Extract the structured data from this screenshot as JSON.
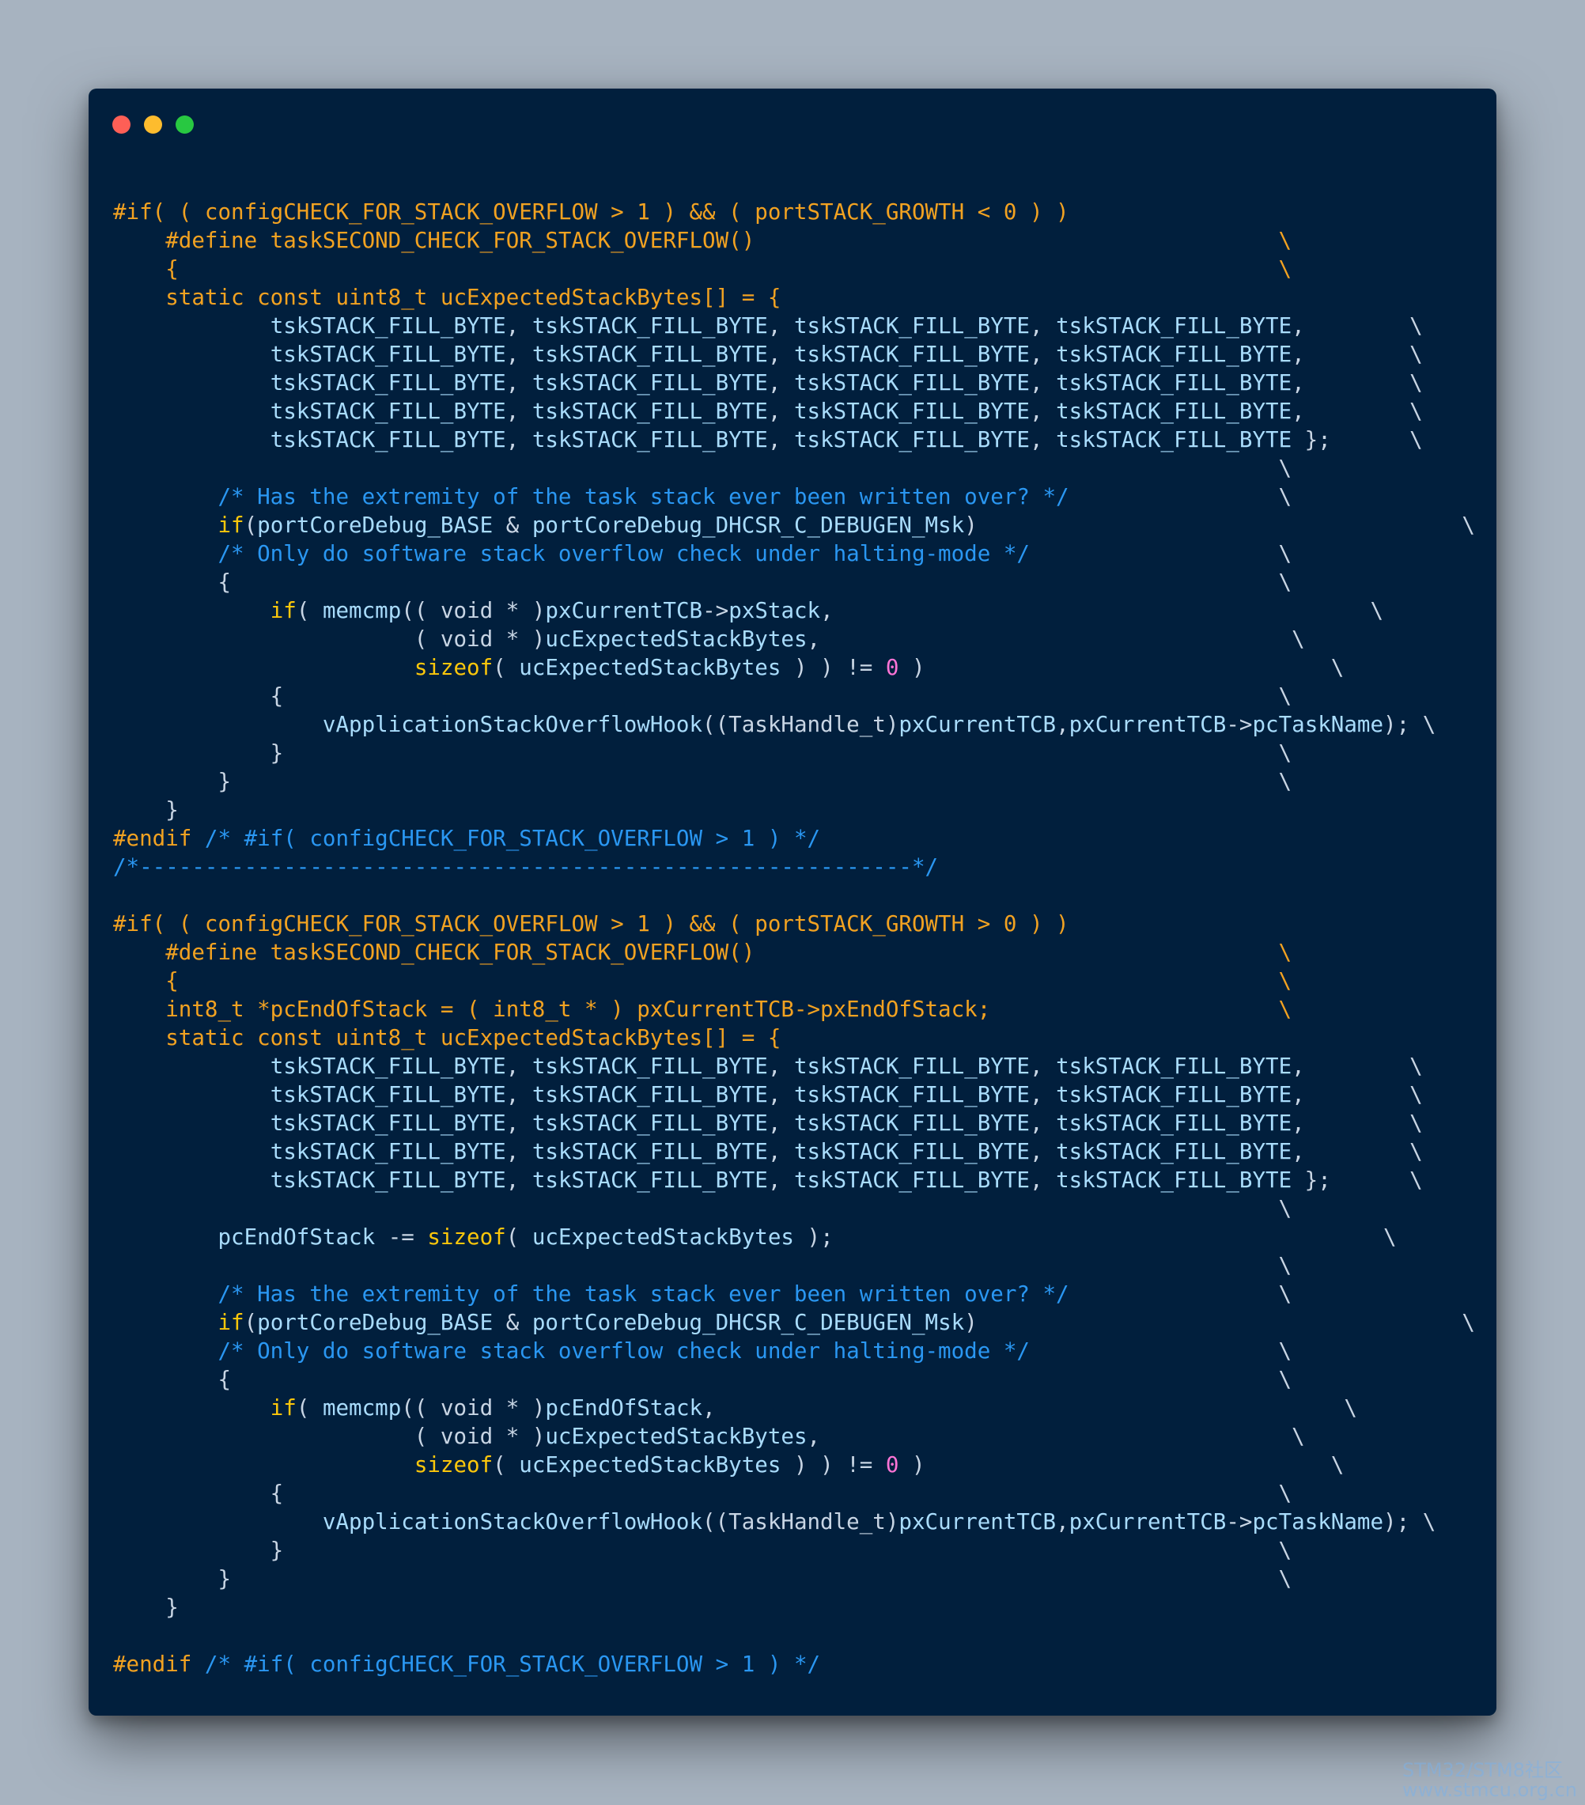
{
  "window": {
    "dots": [
      {
        "name": "close-dot",
        "color": "#fe5f56"
      },
      {
        "name": "minimize-dot",
        "color": "#fdbc2e"
      },
      {
        "name": "maximize-dot",
        "color": "#28c841"
      }
    ]
  },
  "colors": {
    "background": "#a7b3c0",
    "editor": "#011f3d",
    "comment": "#2a97f2",
    "preprocessor": "#f2a221",
    "keyword": "#fcc70b",
    "identifier": "#a9dcfc",
    "number": "#ff74d6",
    "default": "#c8d5e4"
  },
  "code": {
    "lines": [
      [
        [
          "p",
          "#if( ( configCHECK_FOR_STACK_OVERFLOW > 1 ) && ( portSTACK_GROWTH < 0 ) )"
        ]
      ],
      [
        [
          "p",
          "    #define taskSECOND_CHECK_FOR_STACK_OVERFLOW()                                        \\"
        ]
      ],
      [
        [
          "p",
          "    {                                                                                    \\"
        ]
      ],
      [
        [
          "p",
          "    static const uint8_t ucExpectedStackBytes[] = {"
        ]
      ],
      [
        [
          "d",
          "            "
        ],
        [
          "i",
          "tskSTACK_FILL_BYTE"
        ],
        [
          "d",
          ", "
        ],
        [
          "i",
          "tskSTACK_FILL_BYTE"
        ],
        [
          "d",
          ", "
        ],
        [
          "i",
          "tskSTACK_FILL_BYTE"
        ],
        [
          "d",
          ", "
        ],
        [
          "i",
          "tskSTACK_FILL_BYTE"
        ],
        [
          "d",
          ",        \\"
        ]
      ],
      [
        [
          "d",
          "            "
        ],
        [
          "i",
          "tskSTACK_FILL_BYTE"
        ],
        [
          "d",
          ", "
        ],
        [
          "i",
          "tskSTACK_FILL_BYTE"
        ],
        [
          "d",
          ", "
        ],
        [
          "i",
          "tskSTACK_FILL_BYTE"
        ],
        [
          "d",
          ", "
        ],
        [
          "i",
          "tskSTACK_FILL_BYTE"
        ],
        [
          "d",
          ",        \\"
        ]
      ],
      [
        [
          "d",
          "            "
        ],
        [
          "i",
          "tskSTACK_FILL_BYTE"
        ],
        [
          "d",
          ", "
        ],
        [
          "i",
          "tskSTACK_FILL_BYTE"
        ],
        [
          "d",
          ", "
        ],
        [
          "i",
          "tskSTACK_FILL_BYTE"
        ],
        [
          "d",
          ", "
        ],
        [
          "i",
          "tskSTACK_FILL_BYTE"
        ],
        [
          "d",
          ",        \\"
        ]
      ],
      [
        [
          "d",
          "            "
        ],
        [
          "i",
          "tskSTACK_FILL_BYTE"
        ],
        [
          "d",
          ", "
        ],
        [
          "i",
          "tskSTACK_FILL_BYTE"
        ],
        [
          "d",
          ", "
        ],
        [
          "i",
          "tskSTACK_FILL_BYTE"
        ],
        [
          "d",
          ", "
        ],
        [
          "i",
          "tskSTACK_FILL_BYTE"
        ],
        [
          "d",
          ",        \\"
        ]
      ],
      [
        [
          "d",
          "            "
        ],
        [
          "i",
          "tskSTACK_FILL_BYTE"
        ],
        [
          "d",
          ", "
        ],
        [
          "i",
          "tskSTACK_FILL_BYTE"
        ],
        [
          "d",
          ", "
        ],
        [
          "i",
          "tskSTACK_FILL_BYTE"
        ],
        [
          "d",
          ", "
        ],
        [
          "i",
          "tskSTACK_FILL_BYTE"
        ],
        [
          "d",
          " };      \\"
        ]
      ],
      [
        [
          "d",
          "                                                                                         \\"
        ]
      ],
      [
        [
          "c",
          "        /* Has the extremity of the task stack ever been written over? */"
        ],
        [
          "d",
          "                \\"
        ]
      ],
      [
        [
          "d",
          "        "
        ],
        [
          "k",
          "if"
        ],
        [
          "d",
          "("
        ],
        [
          "i",
          "portCoreDebug_BASE"
        ],
        [
          "d",
          " & "
        ],
        [
          "i",
          "portCoreDebug_DHCSR_C_DEBUGEN_Msk"
        ],
        [
          "d",
          ")"
        ],
        [
          "d",
          "                                     \\"
        ]
      ],
      [
        [
          "c",
          "        /* Only do software stack overflow check under halting-mode */"
        ],
        [
          "d",
          "                   \\"
        ]
      ],
      [
        [
          "d",
          "        {                                                                                \\"
        ]
      ],
      [
        [
          "d",
          "            "
        ],
        [
          "k",
          "if"
        ],
        [
          "d",
          "( "
        ],
        [
          "i",
          "memcmp"
        ],
        [
          "d",
          "(( void * )"
        ],
        [
          "i",
          "pxCurrentTCB"
        ],
        [
          "d",
          "->"
        ],
        [
          "i",
          "pxStack"
        ],
        [
          "d",
          ",                                         \\"
        ]
      ],
      [
        [
          "d",
          "                       ( void * )"
        ],
        [
          "i",
          "ucExpectedStackBytes"
        ],
        [
          "d",
          ",                                    \\"
        ]
      ],
      [
        [
          "d",
          "                       "
        ],
        [
          "k",
          "sizeof"
        ],
        [
          "d",
          "( "
        ],
        [
          "i",
          "ucExpectedStackBytes"
        ],
        [
          "d",
          " ) ) != "
        ],
        [
          "n",
          "0"
        ],
        [
          "d",
          " )                               \\"
        ]
      ],
      [
        [
          "d",
          "            {                                                                            \\"
        ]
      ],
      [
        [
          "d",
          "                "
        ],
        [
          "i",
          "vApplicationStackOverflowHook"
        ],
        [
          "d",
          "((TaskHandle_t)"
        ],
        [
          "i",
          "pxCurrentTCB"
        ],
        [
          "d",
          ","
        ],
        [
          "i",
          "pxCurrentTCB"
        ],
        [
          "d",
          "->"
        ],
        [
          "i",
          "pcTaskName"
        ],
        [
          "d",
          "); \\"
        ]
      ],
      [
        [
          "d",
          "            }                                                                            \\"
        ]
      ],
      [
        [
          "d",
          "        }                                                                                \\"
        ]
      ],
      [
        [
          "d",
          "    }"
        ]
      ],
      [
        [
          "p",
          "#endif "
        ],
        [
          "c",
          "/* #if( configCHECK_FOR_STACK_OVERFLOW > 1 ) */"
        ]
      ],
      [
        [
          "c",
          "/*-----------------------------------------------------------*/"
        ]
      ],
      [
        [
          "d",
          ""
        ]
      ],
      [
        [
          "p",
          "#if( ( configCHECK_FOR_STACK_OVERFLOW > 1 ) && ( portSTACK_GROWTH > 0 ) )"
        ]
      ],
      [
        [
          "p",
          "    #define taskSECOND_CHECK_FOR_STACK_OVERFLOW()                                        \\"
        ]
      ],
      [
        [
          "p",
          "    {                                                                                    \\"
        ]
      ],
      [
        [
          "p",
          "    int8_t *pcEndOfStack = ( int8_t * ) pxCurrentTCB->pxEndOfStack;                      \\"
        ]
      ],
      [
        [
          "p",
          "    static const uint8_t ucExpectedStackBytes[] = {"
        ]
      ],
      [
        [
          "d",
          "            "
        ],
        [
          "i",
          "tskSTACK_FILL_BYTE"
        ],
        [
          "d",
          ", "
        ],
        [
          "i",
          "tskSTACK_FILL_BYTE"
        ],
        [
          "d",
          ", "
        ],
        [
          "i",
          "tskSTACK_FILL_BYTE"
        ],
        [
          "d",
          ", "
        ],
        [
          "i",
          "tskSTACK_FILL_BYTE"
        ],
        [
          "d",
          ",        \\"
        ]
      ],
      [
        [
          "d",
          "            "
        ],
        [
          "i",
          "tskSTACK_FILL_BYTE"
        ],
        [
          "d",
          ", "
        ],
        [
          "i",
          "tskSTACK_FILL_BYTE"
        ],
        [
          "d",
          ", "
        ],
        [
          "i",
          "tskSTACK_FILL_BYTE"
        ],
        [
          "d",
          ", "
        ],
        [
          "i",
          "tskSTACK_FILL_BYTE"
        ],
        [
          "d",
          ",        \\"
        ]
      ],
      [
        [
          "d",
          "            "
        ],
        [
          "i",
          "tskSTACK_FILL_BYTE"
        ],
        [
          "d",
          ", "
        ],
        [
          "i",
          "tskSTACK_FILL_BYTE"
        ],
        [
          "d",
          ", "
        ],
        [
          "i",
          "tskSTACK_FILL_BYTE"
        ],
        [
          "d",
          ", "
        ],
        [
          "i",
          "tskSTACK_FILL_BYTE"
        ],
        [
          "d",
          ",        \\"
        ]
      ],
      [
        [
          "d",
          "            "
        ],
        [
          "i",
          "tskSTACK_FILL_BYTE"
        ],
        [
          "d",
          ", "
        ],
        [
          "i",
          "tskSTACK_FILL_BYTE"
        ],
        [
          "d",
          ", "
        ],
        [
          "i",
          "tskSTACK_FILL_BYTE"
        ],
        [
          "d",
          ", "
        ],
        [
          "i",
          "tskSTACK_FILL_BYTE"
        ],
        [
          "d",
          ",        \\"
        ]
      ],
      [
        [
          "d",
          "            "
        ],
        [
          "i",
          "tskSTACK_FILL_BYTE"
        ],
        [
          "d",
          ", "
        ],
        [
          "i",
          "tskSTACK_FILL_BYTE"
        ],
        [
          "d",
          ", "
        ],
        [
          "i",
          "tskSTACK_FILL_BYTE"
        ],
        [
          "d",
          ", "
        ],
        [
          "i",
          "tskSTACK_FILL_BYTE"
        ],
        [
          "d",
          " };      \\"
        ]
      ],
      [
        [
          "d",
          "                                                                                         \\"
        ]
      ],
      [
        [
          "d",
          "        "
        ],
        [
          "i",
          "pcEndOfStack"
        ],
        [
          "d",
          " -= "
        ],
        [
          "k",
          "sizeof"
        ],
        [
          "d",
          "( "
        ],
        [
          "i",
          "ucExpectedStackBytes"
        ],
        [
          "d",
          " );"
        ],
        [
          "d",
          "                                          \\"
        ]
      ],
      [
        [
          "d",
          "                                                                                         \\"
        ]
      ],
      [
        [
          "c",
          "        /* Has the extremity of the task stack ever been written over? */"
        ],
        [
          "d",
          "                \\"
        ]
      ],
      [
        [
          "d",
          "        "
        ],
        [
          "k",
          "if"
        ],
        [
          "d",
          "("
        ],
        [
          "i",
          "portCoreDebug_BASE"
        ],
        [
          "d",
          " & "
        ],
        [
          "i",
          "portCoreDebug_DHCSR_C_DEBUGEN_Msk"
        ],
        [
          "d",
          ")"
        ],
        [
          "d",
          "                                     \\"
        ]
      ],
      [
        [
          "c",
          "        /* Only do software stack overflow check under halting-mode */"
        ],
        [
          "d",
          "                   \\"
        ]
      ],
      [
        [
          "d",
          "        {                                                                                \\"
        ]
      ],
      [
        [
          "d",
          "            "
        ],
        [
          "k",
          "if"
        ],
        [
          "d",
          "( "
        ],
        [
          "i",
          "memcmp"
        ],
        [
          "d",
          "(( void * )"
        ],
        [
          "i",
          "pcEndOfStack"
        ],
        [
          "d",
          ",                                                \\"
        ]
      ],
      [
        [
          "d",
          "                       ( void * )"
        ],
        [
          "i",
          "ucExpectedStackBytes"
        ],
        [
          "d",
          ",                                    \\"
        ]
      ],
      [
        [
          "d",
          "                       "
        ],
        [
          "k",
          "sizeof"
        ],
        [
          "d",
          "( "
        ],
        [
          "i",
          "ucExpectedStackBytes"
        ],
        [
          "d",
          " ) ) != "
        ],
        [
          "n",
          "0"
        ],
        [
          "d",
          " )                               \\"
        ]
      ],
      [
        [
          "d",
          "            {                                                                            \\"
        ]
      ],
      [
        [
          "d",
          "                "
        ],
        [
          "i",
          "vApplicationStackOverflowHook"
        ],
        [
          "d",
          "((TaskHandle_t)"
        ],
        [
          "i",
          "pxCurrentTCB"
        ],
        [
          "d",
          ","
        ],
        [
          "i",
          "pxCurrentTCB"
        ],
        [
          "d",
          "->"
        ],
        [
          "i",
          "pcTaskName"
        ],
        [
          "d",
          "); \\"
        ]
      ],
      [
        [
          "d",
          "            }                                                                            \\"
        ]
      ],
      [
        [
          "d",
          "        }                                                                                \\"
        ]
      ],
      [
        [
          "d",
          "    }"
        ]
      ],
      [
        [
          "d",
          ""
        ]
      ],
      [
        [
          "p",
          "#endif "
        ],
        [
          "c",
          "/* #if( configCHECK_FOR_STACK_OVERFLOW > 1 ) */"
        ]
      ]
    ]
  },
  "watermark": {
    "line1": "STM32/STM8社区",
    "line2": "www.stmcu.org.cn"
  }
}
